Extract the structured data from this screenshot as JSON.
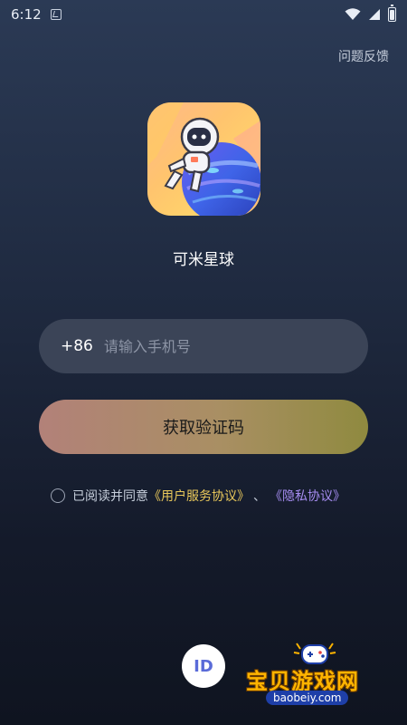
{
  "status_bar": {
    "time": "6:12"
  },
  "header": {
    "feedback_label": "问题反馈"
  },
  "app": {
    "name": "可米星球"
  },
  "phone": {
    "country_code": "+86",
    "placeholder": "请输入手机号",
    "value": ""
  },
  "actions": {
    "get_code_label": "获取验证码",
    "id_login_label": "ID"
  },
  "agreement": {
    "prefix": "已阅读并同意",
    "terms_label": "《用户服务协议》",
    "separator": "、",
    "privacy_label": "《隐私协议》",
    "checked": false
  },
  "watermark": {
    "title": "宝贝游戏网",
    "url": "baobeiy.com"
  },
  "colors": {
    "terms_link": "#e9c85b",
    "privacy_link": "#a58cf0",
    "button_gradient_start": "#b28179",
    "button_gradient_end": "#8f8a3f",
    "input_bg": "#3b4457"
  }
}
